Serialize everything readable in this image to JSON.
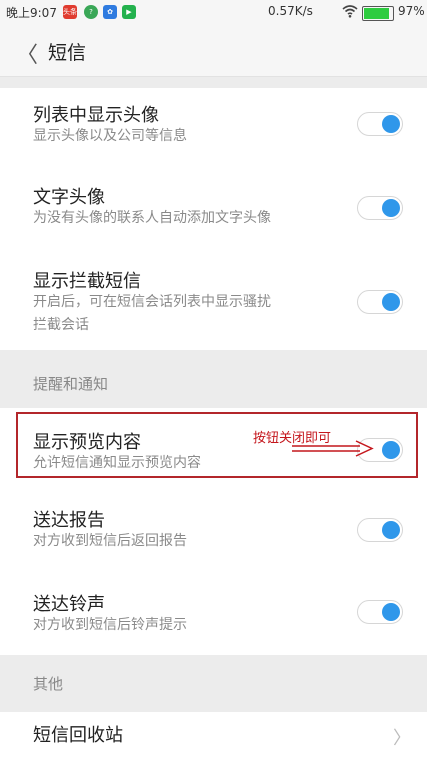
{
  "status_bar": {
    "time": "晚上9:07",
    "speed": "0.57K/s",
    "battery_pct": "97%",
    "battery_level": 0.97,
    "icons": [
      "news-app-icon",
      "question-app-icon",
      "paw-app-icon",
      "play-app-icon",
      "wifi-icon",
      "battery-icon"
    ]
  },
  "header": {
    "title": "短信"
  },
  "display_section": {
    "items": [
      {
        "title": "列表中显示头像",
        "subtitle": "显示头像以及公司等信息",
        "enabled": true
      },
      {
        "title": "文字头像",
        "subtitle": "为没有头像的联系人自动添加文字头像",
        "enabled": true
      },
      {
        "title": "显示拦截短信",
        "subtitle_line1": "开启后，可在短信会话列表中显示骚扰",
        "subtitle_line2": "拦截会话",
        "enabled": true
      }
    ]
  },
  "notify_section": {
    "header": "提醒和通知",
    "items": [
      {
        "title": "显示预览内容",
        "subtitle": "允许短信通知显示预览内容",
        "enabled": true
      },
      {
        "title": "送达报告",
        "subtitle": "对方收到短信后返回报告",
        "enabled": true
      },
      {
        "title": "送达铃声",
        "subtitle": "对方收到短信后铃声提示",
        "enabled": true
      }
    ]
  },
  "other_section": {
    "header": "其他",
    "items": [
      {
        "title": "短信回收站"
      }
    ]
  },
  "annotation": {
    "text": "按钮关闭即可",
    "color": "#c4161c"
  },
  "colors": {
    "accent": "#2f97ea",
    "annotation_border": "#b3262b"
  }
}
